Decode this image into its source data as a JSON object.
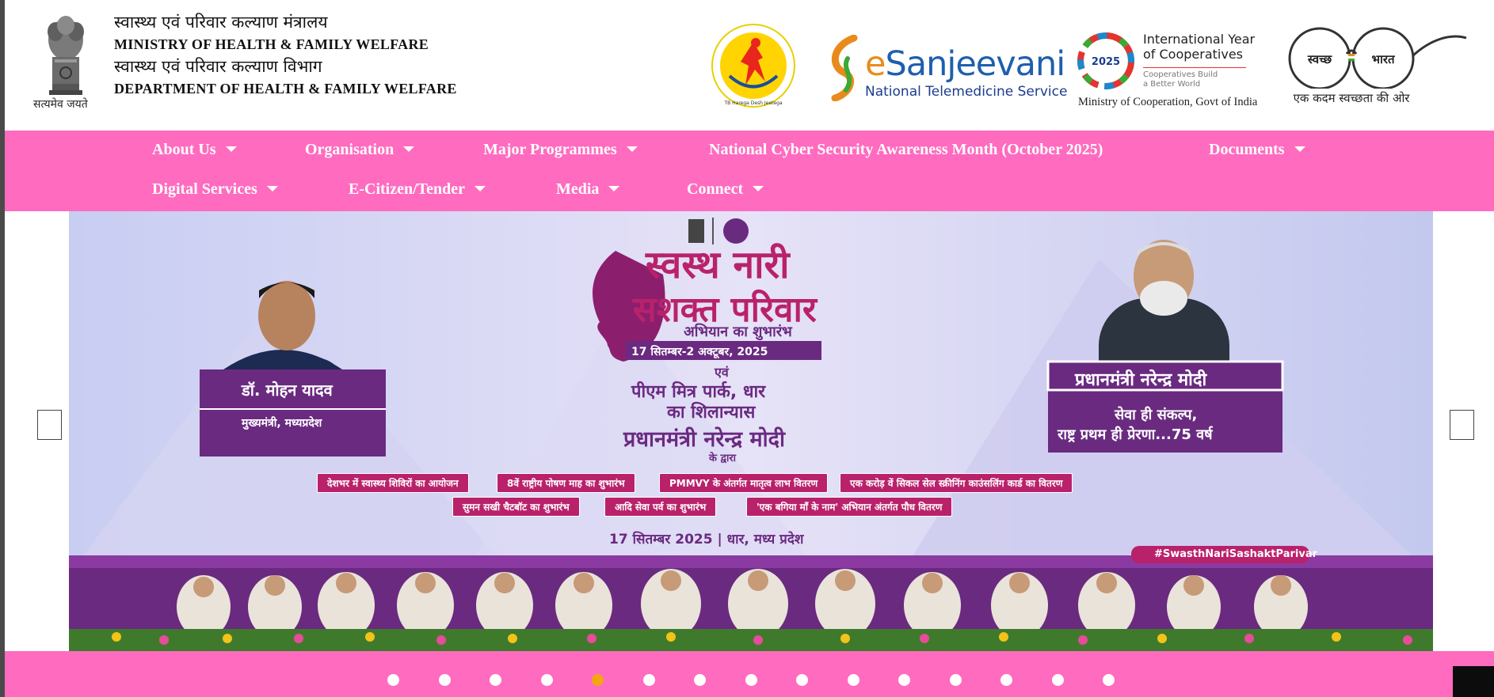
{
  "header": {
    "emblem_motto": "सत्यमेव जयते",
    "ministry_hi": "स्वास्थ्य एवं परिवार कल्याण मंत्रालय",
    "ministry_en": "MINISTRY OF HEALTH & FAMILY WELFARE",
    "department_hi": "स्वास्थ्य एवं परिवार कल्याण विभाग",
    "department_en": "DEPARTMENT OF HEALTH & FAMILY WELFARE",
    "logos": {
      "tb": "NATIONAL TUBERCULOSIS ELIMINATION PROGRAMME",
      "esanjeevani_e": "e",
      "esanjeevani_word": "Sanjeevani",
      "esanjeevani_sub": "National Telemedicine Service",
      "coop_year": "2025",
      "coop_title_1": "International Year",
      "coop_title_2": "of Cooperatives",
      "coop_small_1": "Cooperatives Build",
      "coop_small_2": "a Better World",
      "coop_footer": "Ministry of Cooperation, Govt of India",
      "swachh_left": "स्वच्छ",
      "swachh_right": "भारत",
      "swachh_footer": "एक कदम स्वच्छता की ओर"
    }
  },
  "nav": {
    "home_icon": "",
    "items": [
      {
        "label": "About Us"
      },
      {
        "label": "Organisation"
      },
      {
        "label": "Major Programmes"
      },
      {
        "label": "National Cyber Security Awareness Month (October 2025)"
      },
      {
        "label": "Documents"
      },
      {
        "label": "Digital Services"
      },
      {
        "label": "E-Citizen/Tender"
      },
      {
        "label": "Media"
      },
      {
        "label": "Connect"
      }
    ]
  },
  "banner": {
    "title_1": "स्वस्थ नारी",
    "title_2": "सशक्त परिवार",
    "title_3": "अभियान का शुभारंभ",
    "dates": "17 सितम्बर-2 अक्टूबर, 2025",
    "conj": "एवं",
    "line_1": "पीएम मित्र पार्क, धार",
    "line_2": "का शिलान्यास",
    "pm_line": "प्रधानमंत्री नरेन्द्र मोदी",
    "by": "के द्वारा",
    "left_name": "डॉ. मोहन यादव",
    "left_role": "मुख्यमंत्री, मध्यप्रदेश",
    "right_name": "प्रधानमंत्री नरेन्द्र मोदी",
    "right_line_1": "सेवा ही संकल्प,",
    "right_line_2": "राष्ट्र प्रथम ही प्रेरणा...75 वर्ष",
    "tags": [
      "देशभर में स्वास्थ्य शिविरों का आयोजन",
      "8वें राष्ट्रीय पोषण माह का शुभारंभ",
      "PMMVY के अंतर्गत मातृत्व लाभ वितरण",
      "एक करोड़ वें सिकल सेल स्क्रीनिंग काउंसलिंग कार्ड का वितरण",
      "सुमन सखी चैटबॉट का शुभारंभ",
      "आदि सेवा पर्व का शुभारंभ",
      "'एक बगिया माँ के नाम' अभियान अंतर्गत पौध वितरण"
    ],
    "event_line": "17 सितम्बर 2025 | धार, मध्य प्रदेश",
    "hashtag": "#SwasthNariSashaktParivar"
  },
  "carousel": {
    "prev_icon": "",
    "next_icon": "",
    "slide_count": 15,
    "active_slide": 5
  },
  "scroll_top_icon": ""
}
